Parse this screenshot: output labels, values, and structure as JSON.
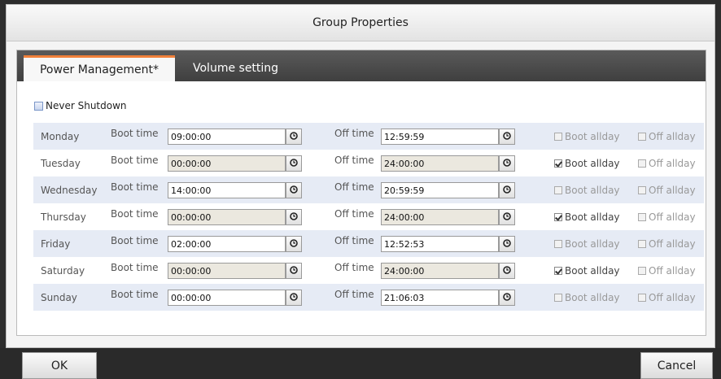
{
  "dialog": {
    "title": "Group Properties"
  },
  "tabs": [
    {
      "label": "Power Management*",
      "active": true
    },
    {
      "label": "Volume setting",
      "active": false
    }
  ],
  "never_shutdown": {
    "label": "Never Shutdown",
    "checked": false
  },
  "labels": {
    "boot_time": "Boot time",
    "off_time": "Off time",
    "boot_allday": "Boot allday",
    "off_allday": "Off allday"
  },
  "schedule": [
    {
      "day": "Monday",
      "boot": "09:00:00",
      "off": "12:59:59",
      "boot_allday": false,
      "off_allday": false
    },
    {
      "day": "Tuesday",
      "boot": "00:00:00",
      "off": "24:00:00",
      "boot_allday": true,
      "off_allday": false
    },
    {
      "day": "Wednesday",
      "boot": "14:00:00",
      "off": "20:59:59",
      "boot_allday": false,
      "off_allday": false
    },
    {
      "day": "Thursday",
      "boot": "00:00:00",
      "off": "24:00:00",
      "boot_allday": true,
      "off_allday": false
    },
    {
      "day": "Friday",
      "boot": "02:00:00",
      "off": "12:52:53",
      "boot_allday": false,
      "off_allday": false
    },
    {
      "day": "Saturday",
      "boot": "00:00:00",
      "off": "24:00:00",
      "boot_allday": true,
      "off_allday": false
    },
    {
      "day": "Sunday",
      "boot": "00:00:00",
      "off": "21:06:03",
      "boot_allday": false,
      "off_allday": false
    }
  ],
  "footer": {
    "ok_label": "OK",
    "cancel_label": "Cancel"
  },
  "colors": {
    "accent": "#f0803a",
    "row_alt": "#e6ebf5",
    "tabbar": "#4a4a4a"
  }
}
